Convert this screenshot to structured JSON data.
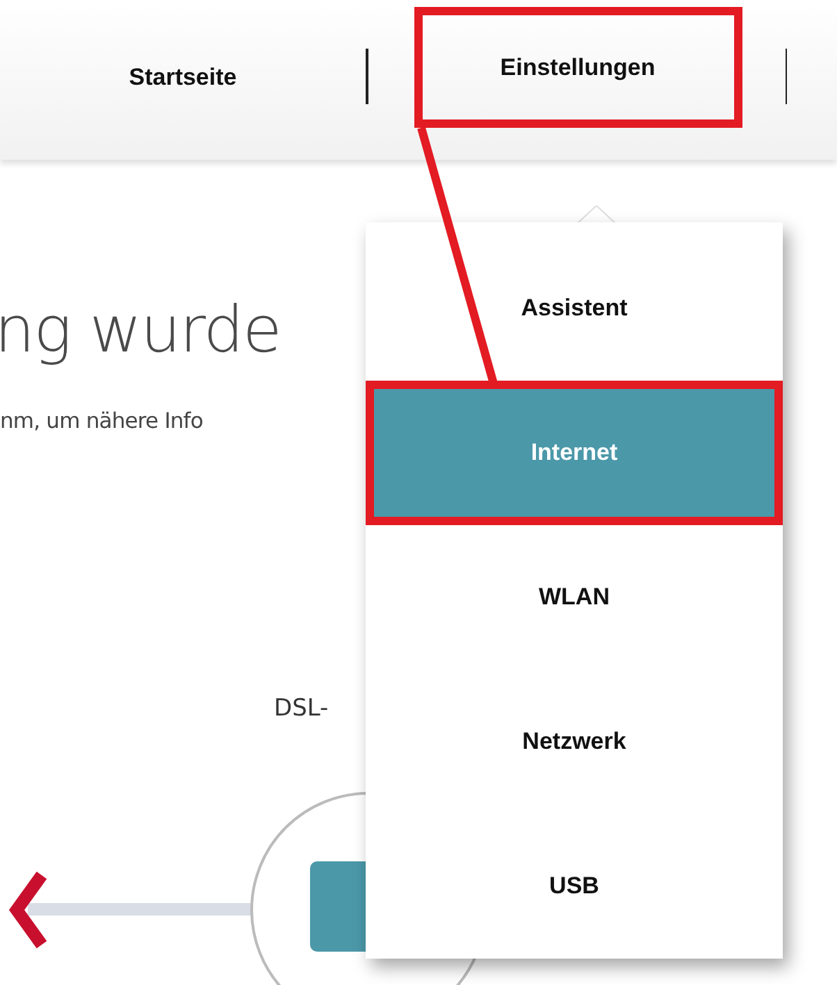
{
  "nav": {
    "items": [
      {
        "label": "Startseite",
        "highlighted": false
      },
      {
        "label": "Einstellungen",
        "highlighted": true
      }
    ]
  },
  "content": {
    "heading": "ng wurde",
    "text": "nm, um nähere Info",
    "diagram_label": "DSL-"
  },
  "menu": {
    "items": [
      {
        "label": "Assistent",
        "selected": false,
        "highlighted": false
      },
      {
        "label": "Internet",
        "selected": true,
        "highlighted": true
      },
      {
        "label": "WLAN",
        "selected": false,
        "highlighted": false
      },
      {
        "label": "Netzwerk",
        "selected": false,
        "highlighted": false
      },
      {
        "label": "USB",
        "selected": false,
        "highlighted": false
      }
    ]
  }
}
